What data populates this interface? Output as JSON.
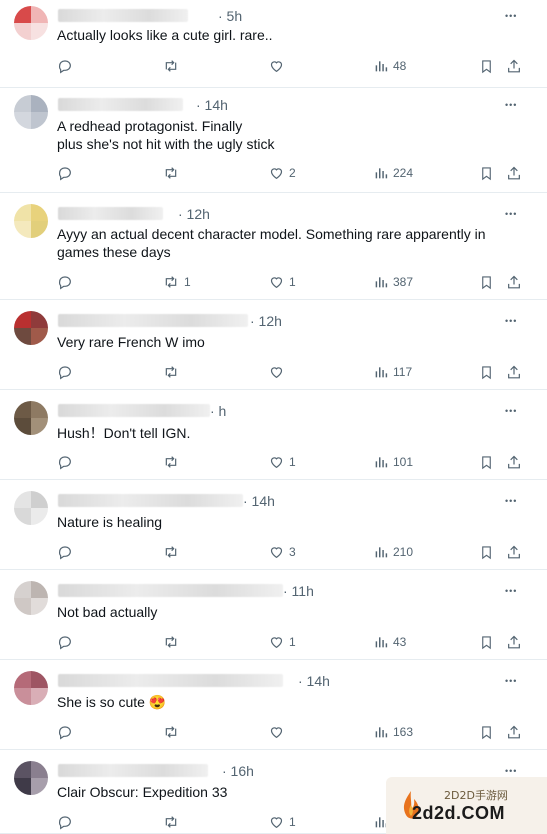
{
  "tweets": [
    {
      "time": "5h",
      "text": "Actually looks like a cute girl. rare..",
      "replies": "",
      "retweets": "",
      "likes": "",
      "views": "48"
    },
    {
      "time": "14h",
      "text": "A redhead protagonist. Finally\nplus she's not hit with the ugly stick",
      "replies": "",
      "retweets": "",
      "likes": "2",
      "views": "224"
    },
    {
      "time": "12h",
      "text": "Ayyy an actual decent character model. Something rare apparently in games these days",
      "replies": "",
      "retweets": "1",
      "likes": "1",
      "views": "387"
    },
    {
      "time": "12h",
      "text": "Very rare French W imo",
      "replies": "",
      "retweets": "",
      "likes": "",
      "views": "117"
    },
    {
      "time": "h",
      "text": "Hush！Don't tell IGN.",
      "replies": "",
      "retweets": "",
      "likes": "1",
      "views": "101"
    },
    {
      "time": "14h",
      "text": "Nature is healing",
      "replies": "",
      "retweets": "",
      "likes": "3",
      "views": "210"
    },
    {
      "time": "11h",
      "text": "Not bad actually",
      "replies": "",
      "retweets": "",
      "likes": "1",
      "views": "43"
    },
    {
      "time": "14h",
      "text": "She is so cute 😍",
      "replies": "",
      "retweets": "",
      "likes": "",
      "views": "163"
    },
    {
      "time": "16h",
      "text": "Clair Obscur: Expedition 33",
      "replies": "",
      "retweets": "",
      "likes": "1",
      "views": ""
    }
  ],
  "watermark": {
    "site_cn": "2D2D手游网",
    "site": "2d2d.COM"
  },
  "more_icon": "more-horizontal-icon",
  "action_icons": [
    "reply-icon",
    "retweet-icon",
    "like-icon",
    "views-icon",
    "bookmark-icon",
    "share-icon"
  ]
}
